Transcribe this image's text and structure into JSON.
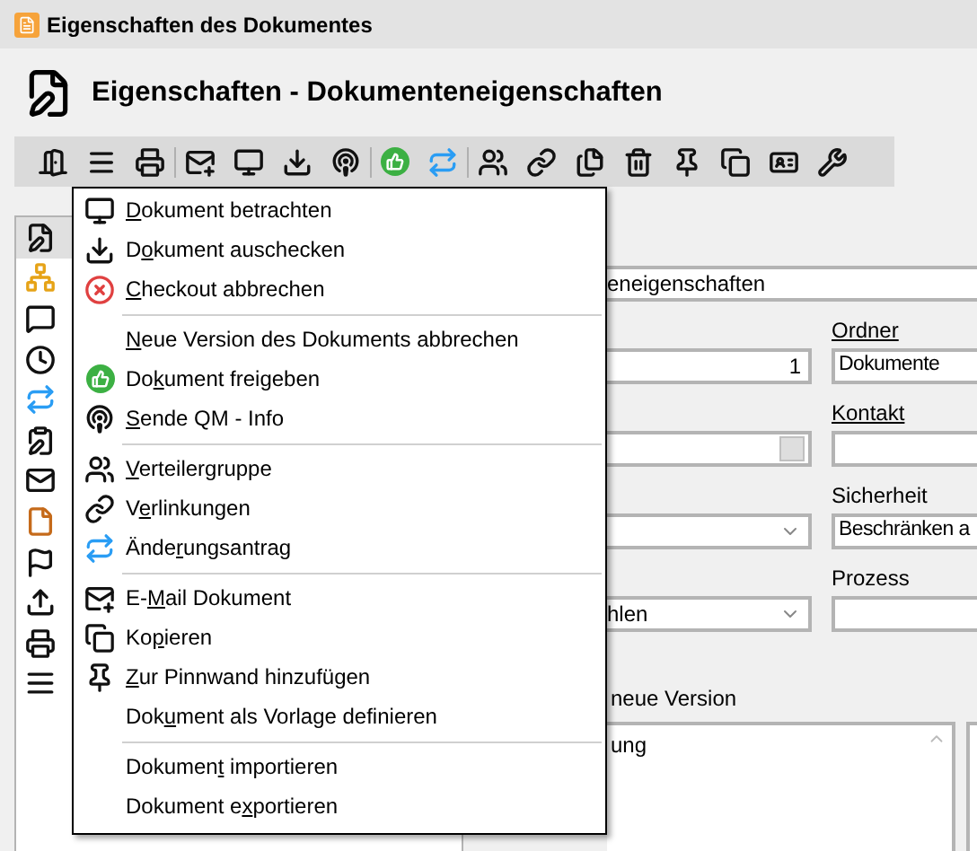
{
  "window": {
    "title": "Eigenschaften des Dokumentes"
  },
  "header": {
    "title": "Eigenschaften - Dokumenteneigenschaften"
  },
  "sidebar": {
    "items": [
      {
        "selected": true
      },
      {
        "selected": false
      },
      {
        "selected": false
      },
      {
        "selected": false
      },
      {
        "selected": false
      },
      {
        "selected": false
      },
      {
        "selected": false
      },
      {
        "selected": false
      },
      {
        "selected": false
      },
      {
        "selected": false
      },
      {
        "selected": false
      },
      {
        "selected": false
      }
    ]
  },
  "form": {
    "title_field": "eneigenschaften",
    "rows": [
      {
        "left": {
          "kind": "number",
          "value": "1"
        },
        "right": {
          "label": "Ordner",
          "link": true,
          "value": "Dokumente"
        }
      },
      {
        "left": {
          "kind": "picker"
        },
        "right": {
          "label": "Kontakt",
          "link": true
        }
      },
      {
        "left": {
          "kind": "select"
        },
        "right": {
          "label": "Sicherheit",
          "link": false,
          "value": "Beschränken a"
        }
      },
      {
        "left": {
          "kind": "select",
          "value": "hlen"
        },
        "right": {
          "label": "Prozess",
          "link": false
        }
      }
    ],
    "notes": {
      "label": "neue Version",
      "value": "ung"
    }
  },
  "menu": {
    "groups": [
      [
        {
          "key": "D",
          "post": "okument betrachten"
        },
        {
          "pre": "D",
          "key": "o",
          "post": "kument auschecken"
        },
        {
          "key": "C",
          "post": "heckout abbrechen"
        }
      ],
      [
        {
          "key": "N",
          "post": "eue Version des Dokuments abbrechen"
        },
        {
          "pre": "Do",
          "key": "k",
          "post": "ument freigeben"
        },
        {
          "key": "S",
          "post": "ende QM - Info"
        }
      ],
      [
        {
          "key": "V",
          "post": "erteilergruppe"
        },
        {
          "pre": "V",
          "key": "e",
          "post": "rlinkungen"
        },
        {
          "pre": "Ände",
          "key": "r",
          "post": "ungsantrag"
        }
      ],
      [
        {
          "pre": "E-",
          "key": "M",
          "post": "ail Dokument"
        },
        {
          "pre": "Ko",
          "key": "p",
          "post": "ieren"
        },
        {
          "key": "Z",
          "post": "ur Pinnwand hinzufügen"
        },
        {
          "pre": "Dok",
          "key": "u",
          "post": "ment als Vorlage definieren"
        }
      ],
      [
        {
          "pre": "Dokumen",
          "key": "t",
          "post": " importieren"
        },
        {
          "pre": "Dokument e",
          "key": "x",
          "post": "portieren"
        }
      ]
    ]
  }
}
